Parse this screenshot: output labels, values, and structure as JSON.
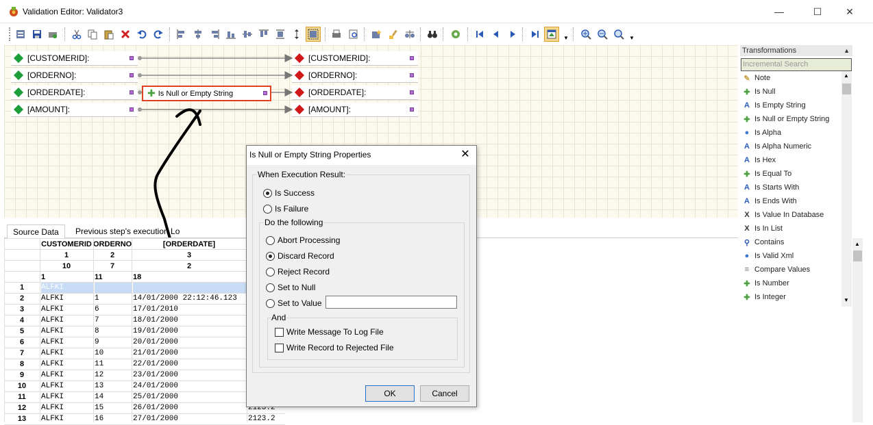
{
  "window": {
    "title": "Validation Editor: Validator3",
    "minimize": "—",
    "maximize": "☐",
    "close": "✕"
  },
  "canvas": {
    "source_fields": [
      "[CUSTOMERID]:",
      "[ORDERNO]:",
      "[ORDERDATE]:",
      "[AMOUNT]:"
    ],
    "target_fields": [
      "[CUSTOMERID]:",
      "[ORDERNO]:",
      "[ORDERDATE]:",
      "[AMOUNT]:"
    ],
    "transform_node": "Is Null or Empty String"
  },
  "transformations": {
    "header": "Transformations",
    "search_placeholder": "Incremental Search",
    "items": [
      {
        "label": "Note",
        "icon": "note-icon"
      },
      {
        "label": "Is Null",
        "icon": "puzzle-icon"
      },
      {
        "label": "Is Empty String",
        "icon": "text-a-icon"
      },
      {
        "label": "Is Null or Empty String",
        "icon": "puzzle-icon"
      },
      {
        "label": "Is Alpha",
        "icon": "globe-icon"
      },
      {
        "label": "Is Alpha Numeric",
        "icon": "text-a-icon"
      },
      {
        "label": "Is Hex",
        "icon": "text-a-icon"
      },
      {
        "label": "Is Equal To",
        "icon": "puzzle-icon"
      },
      {
        "label": "Is Starts With",
        "icon": "text-a-icon"
      },
      {
        "label": "Is Ends With",
        "icon": "text-a-icon"
      },
      {
        "label": "Is Value In Database",
        "icon": "x-variable-icon"
      },
      {
        "label": "Is In List",
        "icon": "x-variable-icon"
      },
      {
        "label": "Contains",
        "icon": "search-icon"
      },
      {
        "label": "Is Valid Xml",
        "icon": "globe-icon"
      },
      {
        "label": "Compare Values",
        "icon": "compare-icon"
      },
      {
        "label": "Is Number",
        "icon": "puzzle-icon"
      },
      {
        "label": "Is Integer",
        "icon": "puzzle-icon"
      }
    ]
  },
  "source_data": {
    "tabs": [
      "Source Data",
      "Previous step's execution Lo"
    ],
    "columns": [
      "CUSTOMERID",
      "ORDERNO",
      "[ORDERDATE]"
    ],
    "col_index": [
      "1",
      "2",
      "3"
    ],
    "col_width": [
      "10",
      "7",
      "2"
    ],
    "col_start": [
      "1",
      "11",
      "18"
    ],
    "rows": [
      {
        "n": "1",
        "c1": "ALFKI",
        "c2": "",
        "c3": "",
        "c4": ""
      },
      {
        "n": "2",
        "c1": "ALFKI",
        "c2": "1",
        "c3": "14/01/2000 22:12:46.123",
        "c4": ""
      },
      {
        "n": "3",
        "c1": "ALFKI",
        "c2": "6",
        "c3": "17/01/2010",
        "c4": ""
      },
      {
        "n": "4",
        "c1": "ALFKI",
        "c2": "7",
        "c3": "18/01/2000",
        "c4": ""
      },
      {
        "n": "5",
        "c1": "ALFKI",
        "c2": "8",
        "c3": "19/01/2000",
        "c4": ""
      },
      {
        "n": "6",
        "c1": "ALFKI",
        "c2": "9",
        "c3": "20/01/2000",
        "c4": ""
      },
      {
        "n": "7",
        "c1": "ALFKI",
        "c2": "10",
        "c3": "21/01/2000",
        "c4": ""
      },
      {
        "n": "8",
        "c1": "ALFKI",
        "c2": "11",
        "c3": "22/01/2000",
        "c4": ""
      },
      {
        "n": "9",
        "c1": "ALFKI",
        "c2": "12",
        "c3": "23/01/2000",
        "c4": ""
      },
      {
        "n": "10",
        "c1": "ALFKI",
        "c2": "13",
        "c3": "24/01/2000",
        "c4": ""
      },
      {
        "n": "11",
        "c1": "ALFKI",
        "c2": "14",
        "c3": "25/01/2000",
        "c4": ""
      },
      {
        "n": "12",
        "c1": "ALFKI",
        "c2": "15",
        "c3": "26/01/2000",
        "c4": "2123.2"
      },
      {
        "n": "13",
        "c1": "ALFKI",
        "c2": "16",
        "c3": "27/01/2000",
        "c4": "2123.2"
      }
    ]
  },
  "dialog": {
    "title": "Is Null or Empty String Properties",
    "group1_label": "When Execution Result:",
    "result_options": [
      "Is Success",
      "Is Failure"
    ],
    "selected_result": "Is Success",
    "group2_label": "Do the following",
    "action_options": [
      "Abort Processing",
      "Discard Record",
      "Reject Record",
      "Set to Null",
      "Set to Value"
    ],
    "selected_action": "Discard Record",
    "set_value": "",
    "group3_label": "And",
    "checks": [
      {
        "label": "Write Message To Log File",
        "checked": false
      },
      {
        "label": "Write Record to Rejected  File",
        "checked": false
      }
    ],
    "ok": "OK",
    "cancel": "Cancel"
  },
  "colors": {
    "source_diamond": "#1e9e3a",
    "target_diamond": "#d01818",
    "node_border": "#e04020",
    "selected_cell": "#c8dcf5"
  }
}
